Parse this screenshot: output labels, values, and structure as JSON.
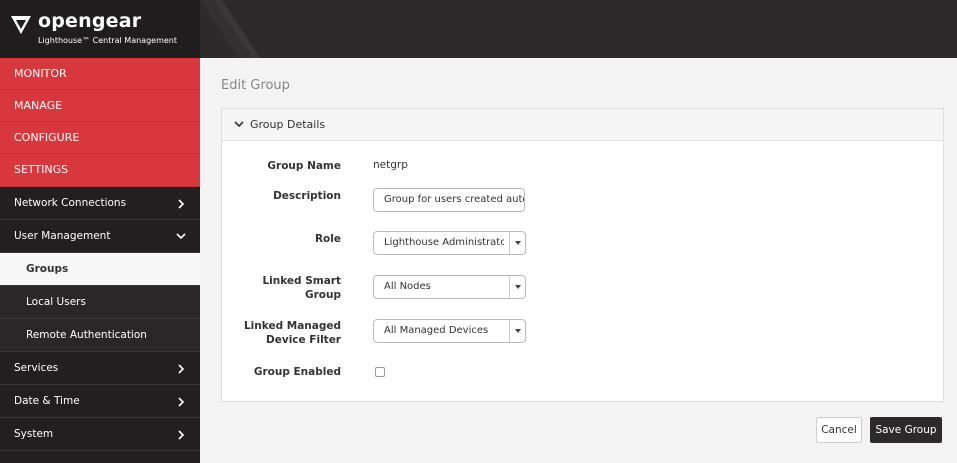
{
  "brand": {
    "name": "opengear",
    "subtitle": "Lighthouse™ Central Management"
  },
  "sidebar": {
    "sections": [
      {
        "label": "MONITOR"
      },
      {
        "label": "MANAGE"
      },
      {
        "label": "CONFIGURE"
      },
      {
        "label": "SETTINGS"
      }
    ],
    "items": [
      {
        "label": "Network Connections"
      },
      {
        "label": "User Management"
      },
      {
        "label": "Groups"
      },
      {
        "label": "Local Users"
      },
      {
        "label": "Remote Authentication"
      },
      {
        "label": "Services"
      },
      {
        "label": "Date & Time"
      },
      {
        "label": "System"
      }
    ]
  },
  "page": {
    "title": "Edit Group"
  },
  "panel": {
    "title": "Group Details"
  },
  "form": {
    "group_name": {
      "label": "Group Name",
      "value": "netgrp"
    },
    "description": {
      "label": "Description",
      "value": "Group for users created auto"
    },
    "role": {
      "label": "Role",
      "value": "Lighthouse Administrato"
    },
    "linked_smart_group": {
      "label_line1": "Linked Smart",
      "label_line2": "Group",
      "value": "All Nodes"
    },
    "linked_device_filter": {
      "label_line1": "Linked Managed",
      "label_line2": "Device Filter",
      "value": "All Managed Devices"
    },
    "group_enabled": {
      "label": "Group Enabled",
      "checked": false
    }
  },
  "actions": {
    "cancel": "Cancel",
    "save": "Save Group"
  },
  "colors": {
    "accent": "#d9373e",
    "sidebar": "#231f20",
    "topbar": "#2d2a2b"
  }
}
